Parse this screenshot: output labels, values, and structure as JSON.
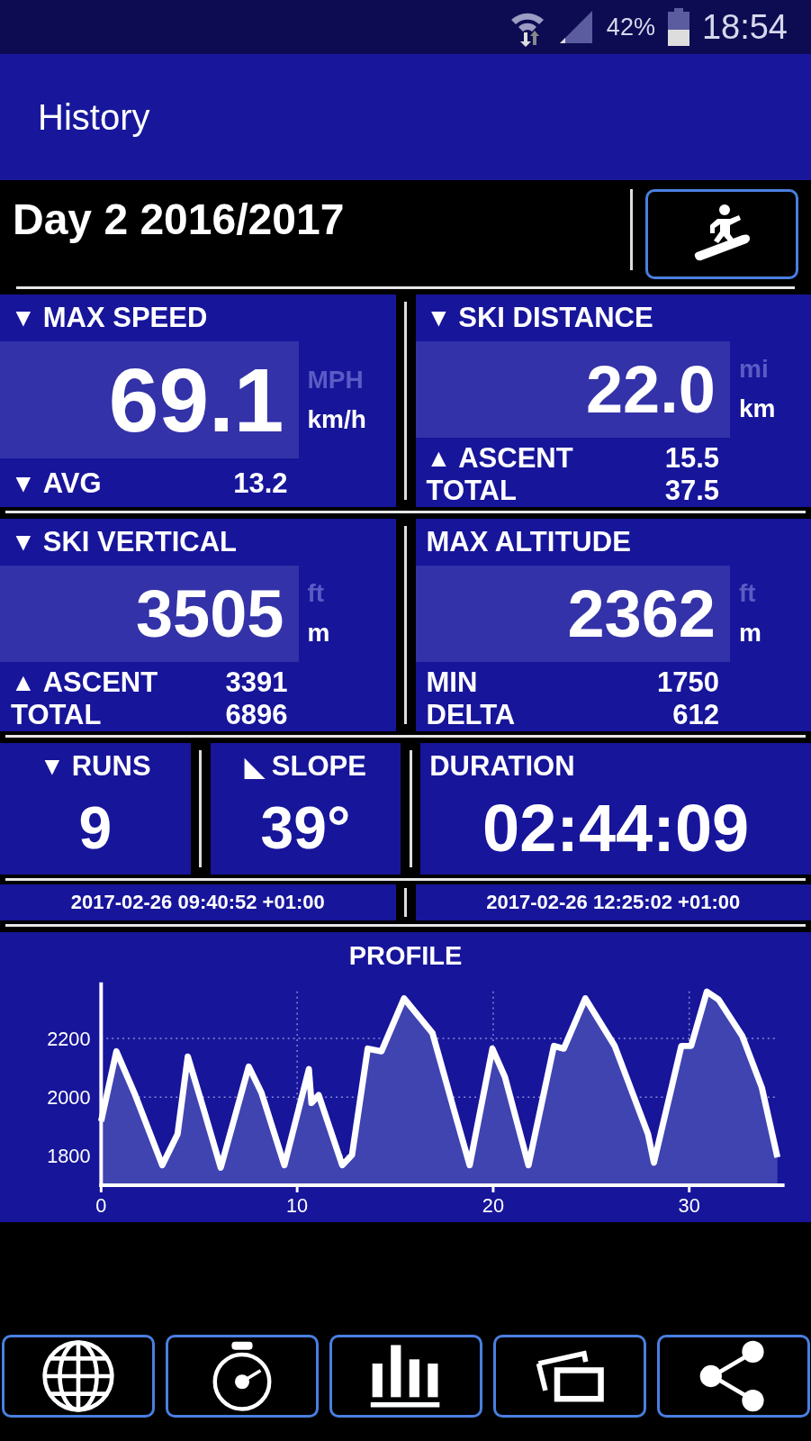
{
  "status_bar": {
    "battery": "42%",
    "time": "18:54"
  },
  "app_bar": {
    "title": "History"
  },
  "header": {
    "title": "Day 2 2016/2017"
  },
  "card_rows": [
    {
      "cards": [
        {
          "kind": "metric",
          "arrow": "▼",
          "label": "MAX SPEED",
          "value": "69.1",
          "big": true,
          "units": [
            {
              "label": "MPH",
              "selected": false
            },
            {
              "label": "km/h",
              "selected": true
            }
          ],
          "rows": [
            {
              "arrow": "▼",
              "label": "AVG",
              "value": "13.2"
            }
          ]
        },
        {
          "kind": "metric",
          "arrow": "▼",
          "label": "SKI DISTANCE",
          "value": "22.0",
          "big": false,
          "units": [
            {
              "label": "mi",
              "selected": false
            },
            {
              "label": "km",
              "selected": true
            }
          ],
          "rows": [
            {
              "arrow": "▲",
              "label": "ASCENT",
              "value": "15.5"
            },
            {
              "label": "TOTAL",
              "value": "37.5"
            }
          ]
        }
      ]
    },
    {
      "cards": [
        {
          "kind": "metric",
          "arrow": "▼",
          "label": "SKI VERTICAL",
          "value": "3505",
          "big": false,
          "units": [
            {
              "label": "ft",
              "selected": false
            },
            {
              "label": "m",
              "selected": true
            }
          ],
          "rows": [
            {
              "arrow": "▲",
              "label": "ASCENT",
              "value": "3391"
            },
            {
              "label": "TOTAL",
              "value": "6896"
            }
          ]
        },
        {
          "kind": "metric",
          "label": "MAX ALTITUDE",
          "value": "2362",
          "big": false,
          "units": [
            {
              "label": "ft",
              "selected": false
            },
            {
              "label": "m",
              "selected": true
            }
          ],
          "rows": [
            {
              "label": "MIN",
              "value": "1750"
            },
            {
              "label": "DELTA",
              "value": "612"
            }
          ]
        }
      ]
    },
    {
      "cards": [
        {
          "kind": "simple",
          "arrow": "▼",
          "label": "RUNS",
          "value": "9",
          "wide": false
        },
        {
          "kind": "simple",
          "arrow": "◣",
          "label": "SLOPE",
          "value": "39°",
          "wide": false
        },
        {
          "kind": "simple",
          "label": "DURATION",
          "value": "02:44:09",
          "wide": true
        }
      ]
    }
  ],
  "timestamps": [
    "2017-02-26 09:40:52 +01:00",
    "2017-02-26 12:25:02 +01:00"
  ],
  "profile": {
    "chart_data": {
      "type": "area",
      "title": "PROFILE",
      "x": [
        0,
        0.78,
        1.69,
        3.12,
        3.9,
        4.42,
        5.2,
        6.1,
        7.53,
        8.18,
        9.35,
        10.6,
        10.73,
        11.1,
        12.3,
        12.8,
        13.6,
        14.3,
        15.45,
        16.9,
        18.05,
        18.8,
        19.96,
        20.6,
        21.8,
        23.1,
        23.6,
        24.7,
        26.2,
        27.9,
        28.2,
        29.6,
        30.1,
        30.9,
        31.5,
        32.7,
        33.7,
        34.5
      ],
      "grid": true,
      "series": [
        {
          "color": "#ffffff",
          "values": [
            1918,
            2156,
            2015,
            1768,
            1874,
            2138,
            1965,
            1760,
            2104,
            2015,
            1768,
            2095,
            1980,
            2007,
            1768,
            1803,
            2165,
            2156,
            2336,
            2218,
            1945,
            1768,
            2165,
            2068,
            1768,
            2174,
            2165,
            2336,
            2174,
            1874,
            1777,
            2174,
            2174,
            2359,
            2332,
            2209,
            2033,
            1795
          ]
        }
      ],
      "xlim": [
        0,
        34.5
      ],
      "ylim": [
        1700,
        2360
      ],
      "xticks": [
        0,
        10,
        20,
        30
      ],
      "yticks": [
        1800,
        2000,
        2200
      ]
    }
  }
}
